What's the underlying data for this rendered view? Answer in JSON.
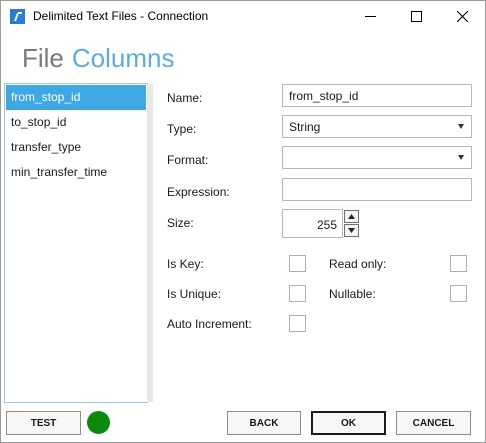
{
  "window": {
    "title": "Delimited Text Files - Connection"
  },
  "heading": {
    "file": "File",
    "columns": "Columns"
  },
  "columns": {
    "items": [
      "from_stop_id",
      "to_stop_id",
      "transfer_type",
      "min_transfer_time"
    ],
    "selected": "from_stop_id"
  },
  "form": {
    "name_label": "Name:",
    "name_value": "from_stop_id",
    "type_label": "Type:",
    "type_value": "String",
    "format_label": "Format:",
    "format_value": "",
    "expression_label": "Expression:",
    "expression_value": "",
    "size_label": "Size:",
    "size_value": "255",
    "is_key_label": "Is Key:",
    "read_only_label": "Read only:",
    "is_unique_label": "Is Unique:",
    "nullable_label": "Nullable:",
    "auto_increment_label": "Auto Increment:"
  },
  "footer": {
    "test_label": "TEST",
    "back_label": "BACK",
    "ok_label": "OK",
    "cancel_label": "CANCEL"
  },
  "colors": {
    "accent": "#3ea8e5",
    "heading_accent": "#5aaedc",
    "status_ok": "#0b8a0b"
  },
  "icons": {
    "app": "database-connection-icon",
    "status": "connection-status-icon"
  }
}
